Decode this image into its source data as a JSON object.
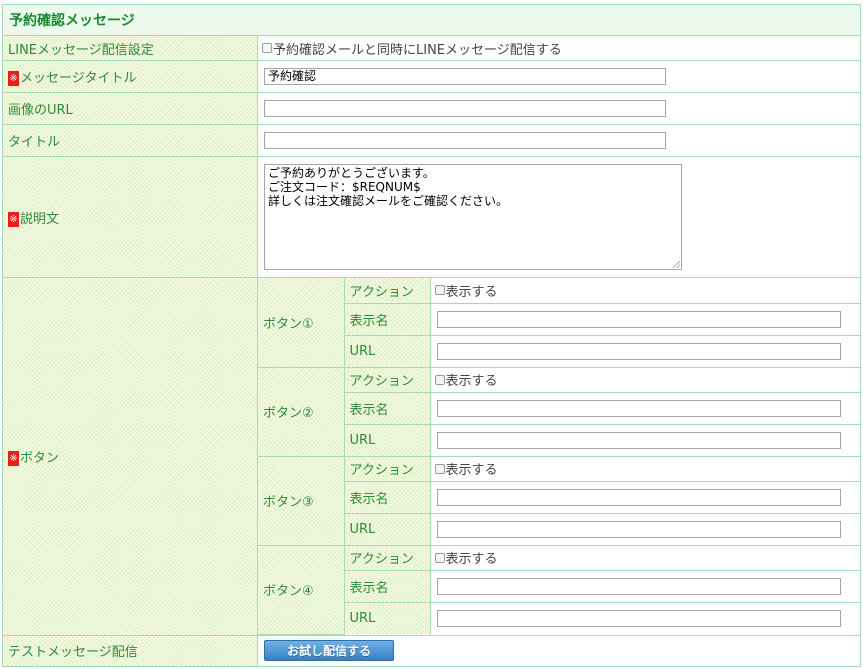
{
  "header": {
    "title": "予約確認メッセージ"
  },
  "line_setting": {
    "label": "LINEメッセージ配信設定",
    "checkbox_label": "予約確認メールと同時にLINEメッセージ配信する"
  },
  "message_title": {
    "required_mark": "※",
    "label": "メッセージタイトル",
    "value": "予約確認"
  },
  "image_url": {
    "label": "画像のURL",
    "value": ""
  },
  "title": {
    "label": "タイトル",
    "value": ""
  },
  "description": {
    "required_mark": "※",
    "label": "説明文",
    "value": "ご予約ありがとうございます。\nご注文コード：$REQNUM$\n詳しくは注文確認メールをご確認ください。"
  },
  "buttons": {
    "required_mark": "※",
    "label": "ボタン",
    "field_labels": {
      "action": "アクション",
      "display_name": "表示名",
      "url": "URL"
    },
    "show_label": "表示する",
    "items": [
      {
        "name": "ボタン①",
        "display_name": "",
        "url": ""
      },
      {
        "name": "ボタン②",
        "display_name": "",
        "url": ""
      },
      {
        "name": "ボタン③",
        "display_name": "",
        "url": ""
      },
      {
        "name": "ボタン④",
        "display_name": "",
        "url": ""
      }
    ]
  },
  "test_message": {
    "label": "テストメッセージ配信",
    "button_label": "お試し配信する"
  },
  "colors": {
    "header_bg": "#ecfaee",
    "header_text": "#1a8a2e",
    "label_text": "#2d8a3a",
    "border": "#a9d9b6",
    "required_bg": "#e8201a",
    "button_bg": "#3880c3"
  }
}
